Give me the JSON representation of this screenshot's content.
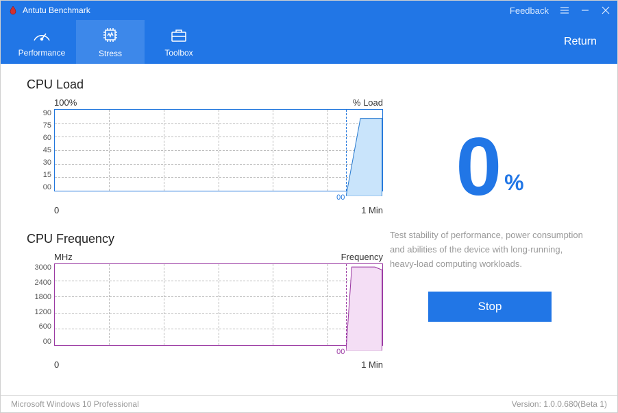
{
  "app": {
    "title": "Antutu Benchmark"
  },
  "titlebar": {
    "feedback": "Feedback"
  },
  "menubar": {
    "performance": "Performance",
    "stress": "Stress",
    "toolbox": "Toolbox",
    "return": "Return"
  },
  "charts": {
    "load": {
      "title": "CPU Load",
      "top_left": "100%",
      "top_right": "% Load",
      "y_ticks": [
        "90",
        "75",
        "60",
        "45",
        "30",
        "15",
        "00"
      ],
      "x_left": "0",
      "x_right": "1 Min",
      "data_start_label": "00"
    },
    "freq": {
      "title": "CPU Frequency",
      "top_left": "MHz",
      "top_right": "Frequency",
      "y_ticks": [
        "3000",
        "2400",
        "1800",
        "1200",
        "600",
        "00"
      ],
      "x_left": "0",
      "x_right": "1 Min",
      "data_start_label": "00"
    }
  },
  "result": {
    "value": "0",
    "unit": "%",
    "description": "Test stability of performance, power consumption and abilities of the device with long-running, heavy-load computing workloads.",
    "stop_label": "Stop"
  },
  "footer": {
    "os": "Microsoft Windows 10 Professional",
    "version": "Version: 1.0.0.680(Beta 1)"
  },
  "chart_data": [
    {
      "type": "area",
      "title": "CPU Load",
      "ylabel": "% Load",
      "ylim": [
        0,
        100
      ],
      "xlim_label": [
        "0",
        "1 Min"
      ],
      "x": [
        0,
        3,
        6
      ],
      "values": [
        0,
        90,
        90
      ],
      "note": "x is seconds elapsed from start; filled region from x=0 to current (~6% of 1 Min)"
    },
    {
      "type": "area",
      "title": "CPU Frequency",
      "ylabel": "MHz",
      "ylim": [
        0,
        3400
      ],
      "xlim_label": [
        "0",
        "1 Min"
      ],
      "x": [
        0,
        1.5,
        3,
        6
      ],
      "values": [
        0,
        3300,
        3300,
        3250
      ],
      "note": "x is seconds elapsed from start; filled region near right edge"
    }
  ]
}
